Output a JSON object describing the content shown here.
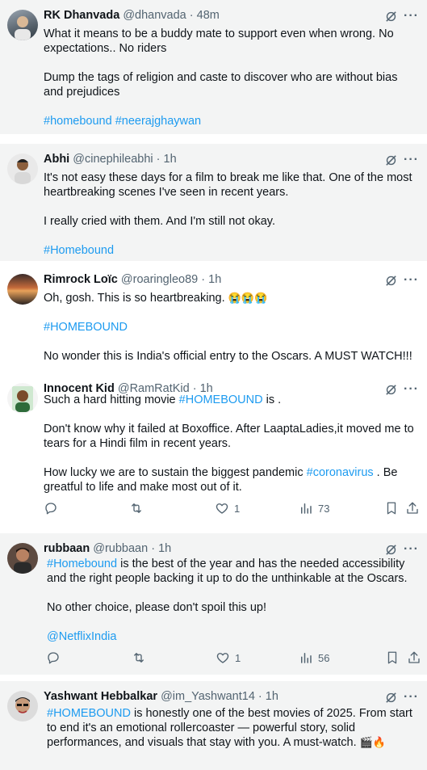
{
  "tweets": [
    {
      "name": "RK Dhanvada",
      "handle": "@dhanvada",
      "sep": "·",
      "time": "48m",
      "lines": [
        "What it means to be a buddy mate to support even when wrong. No expectations.. No riders",
        "Dump the tags of religion and caste to discover who are without bias and prejudices"
      ],
      "tags": [
        "#homebound",
        "#neerajghaywan"
      ]
    },
    {
      "name": "Abhi",
      "handle": "@cinephileabhi",
      "sep": "·",
      "time": "1h",
      "lines": [
        "It's not easy these days for a film to break me like that. One of the most heartbreaking scenes I've seen in recent years.",
        "I really cried with them. And I'm still not okay."
      ],
      "tags": [
        "#Homebound"
      ]
    },
    {
      "name": "Rimrock Loïc",
      "handle": "@roaringleo89",
      "sep": "·",
      "time": "1h",
      "line1": "Oh, gosh. This is so heartbreaking.",
      "emoji1": "😭😭😭",
      "tag": "#HOMEBOUND",
      "line2": "No wonder this is India's official entry to the Oscars. A MUST WATCH!!!"
    },
    {
      "name": "Innocent Kid",
      "handle": "@RamRatKid",
      "sep": "·",
      "time": "1h",
      "p1_a": "Such a hard hitting movie ",
      "p1_tag": "#HOMEBOUND",
      "p1_b": " is .",
      "p2": "Don't know why it failed at Boxoffice. After LaaptaLadies,it moved me to tears for a Hindi film in recent years.",
      "p3_a": "How lucky we are to sustain the biggest pandemic ",
      "p3_tag": "#coronavirus",
      "p3_b": " . Be greatful to life and make most out of it.",
      "likes": "1",
      "views": "73"
    },
    {
      "name": "rubbaan",
      "handle": "@rubbaan",
      "sep": "·",
      "time": "1h",
      "p1_tag": "#Homebound",
      "p1_b": " is the best of the year and has the needed accessibility and the right people backing it up to do the unthinkable at the Oscars.",
      "p2": "No other choice, please don't spoil this up!",
      "mention": "@NetflixIndia",
      "likes": "1",
      "views": "56"
    },
    {
      "name": "Yashwant Hebbalkar",
      "handle": "@im_Yashwant14",
      "sep": "·",
      "time": "1h",
      "p1_tag": "#HOMEBOUND",
      "p1_b": " is honestly one of the best movies of 2025. From start to end it's an emotional rollercoaster — powerful story, solid performances, and visuals that stay with you. A must-watch.",
      "emoji": "🎬🔥"
    }
  ],
  "icons": {
    "more": "···",
    "grok": "grok-icon",
    "reply": "reply-icon",
    "retweet": "retweet-icon",
    "like": "heart-icon",
    "views": "views-icon",
    "bookmark": "bookmark-icon",
    "share": "share-icon"
  },
  "colors": {
    "link": "#1d9bf0",
    "muted": "#536471",
    "card_bg": "#f3f4f4"
  }
}
